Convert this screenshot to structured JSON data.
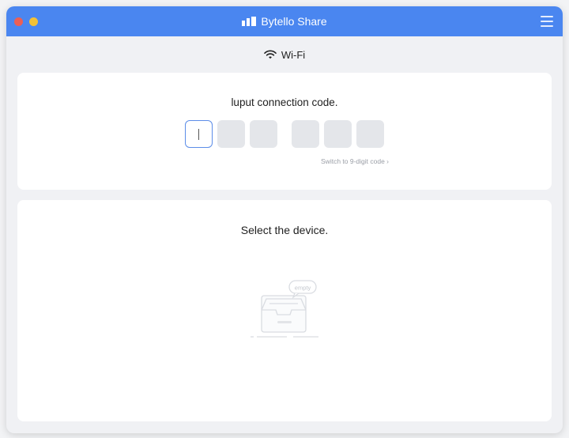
{
  "window": {
    "title": "Bytello Share",
    "traffic_lights": [
      "close",
      "minimize"
    ],
    "colors": {
      "titlebar": "#4a86f0",
      "close": "#ec5f55",
      "minimize": "#f3c136",
      "active_border": "#5c8de8"
    }
  },
  "network": {
    "icon": "wifi-icon",
    "label": "Wi-Fi"
  },
  "code_panel": {
    "prompt": "luput connection code.",
    "digit_count": 6,
    "switch_label": "Switch to 9-digit code ›"
  },
  "device_panel": {
    "title": "Select the device.",
    "empty_label": "empty"
  }
}
